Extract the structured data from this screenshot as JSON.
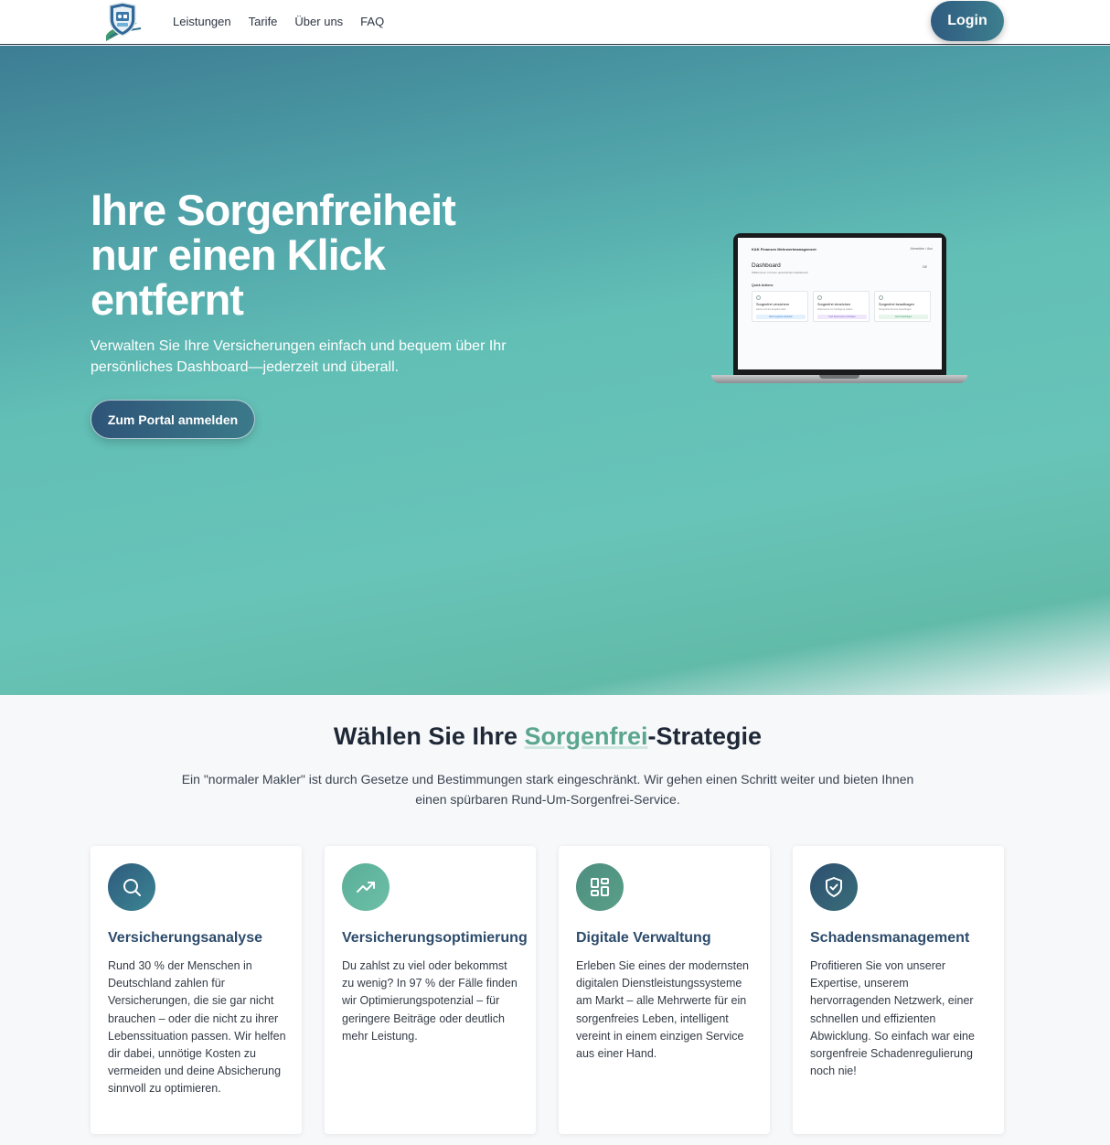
{
  "nav": {
    "links": [
      "Leistungen",
      "Tarife",
      "Über uns",
      "FAQ"
    ],
    "login_label": "Login"
  },
  "hero": {
    "title": "Ihre Sorgenfreiheit nur einen Klick entfernt",
    "subtitle": "Verwalten Sie Ihre Versicherungen einfach und bequem über Ihr persönliches Dashboard—jederzeit und überall.",
    "cta_label": "Zum Portal anmelden"
  },
  "laptop_screen": {
    "brand": "K&K Finanzen Mehrwertmanagement",
    "logout": "Abmelden / Aus",
    "title": "Dashboard",
    "description": "Willkommen in Ihrem persönlichen Dashboard",
    "language": "DE",
    "quick_actions": "Quick Actions",
    "cards": [
      {
        "title": "Sorgenfrei versichern",
        "desc": "Hierzu ist kein Angebot aktiv",
        "button": "Nach Angebot anfordern",
        "btn_bg": "#e3f1ff",
        "btn_fg": "#3b7fc4",
        "dot": "#5a9bd6"
      },
      {
        "title": "Sorgenfrei einreichen",
        "desc": "Dokumente zur Verfügung stellen",
        "button": "Jetzt Dokumente hochladen",
        "btn_bg": "#efe8fb",
        "btn_fg": "#7d5bc2",
        "dot": "#9b7ad8"
      },
      {
        "title": "Sorgenfrei beauftragen",
        "desc": "Sorgenfrei-Service beauftragen",
        "button": "Jetzt beauftragen",
        "btn_bg": "#e6f6ec",
        "btn_fg": "#3e9a63",
        "dot": "#4fb07a"
      }
    ]
  },
  "strategy": {
    "title_before": "Wählen Sie Ihre ",
    "title_highlight": "Sorgenfrei",
    "title_after": "-Strategie",
    "description": "Ein \"normaler Makler\" ist durch Gesetze und Bestimmungen stark eingeschränkt. Wir gehen einen Schritt weiter und bieten Ihnen einen spürbaren Rund-Um-Sorgenfrei-Service."
  },
  "cards": [
    {
      "title": "Versicherungsanalyse",
      "text": "Rund 30 % der Menschen in Deutschland zahlen für Versicherungen, die sie gar nicht brauchen – oder die nicht zu ihrer Lebenssituation passen. Wir helfen dir dabei, unnötige Kosten zu vermeiden und deine Absicherung sinnvoll zu optimieren.",
      "icon": "search-icon",
      "color_from": "#2f5b7d",
      "color_to": "#3b8593"
    },
    {
      "title": "Versicherungsoptimierung",
      "text": "Du zahlst zu viel oder bekommst zu wenig? In 97 % der Fälle finden wir Optimierungspotenzial – für geringere Beiträge oder deutlich mehr Leistung.",
      "icon": "trending-up-icon",
      "color_from": "#5aae99",
      "color_to": "#6dbfa6"
    },
    {
      "title": "Digitale Verwaltung",
      "text": "Erleben Sie eines der modernsten digitalen Dienstleistungssysteme am Markt – alle Mehrwerte für ein sorgenfreies Leben, intelligent vereint in einem einzigen Service aus einer Hand.",
      "icon": "dashboard-icon",
      "color_from": "#4d8e80",
      "color_to": "#5a9f87"
    },
    {
      "title": "Schadensmanagement",
      "text": "Profitieren Sie von unserer Expertise, unserem hervorragenden Netzwerk, einer schnellen und effizienten Abwicklung. So einfach war eine sorgenfreie Schadenregulierung noch nie!",
      "icon": "shield-check-icon",
      "color_from": "#2d4f70",
      "color_to": "#3a6e79"
    }
  ]
}
